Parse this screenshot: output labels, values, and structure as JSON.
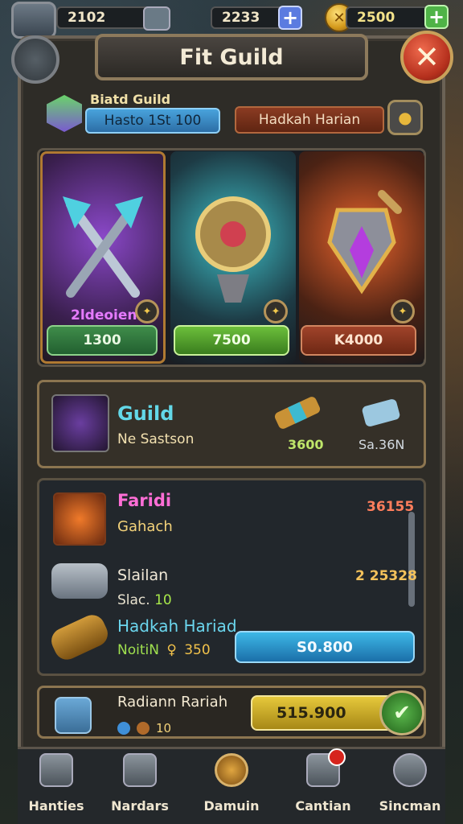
{
  "header": {
    "stat_left": "2102",
    "stat_mid": "2233",
    "stat_right": "2500",
    "title": "Fit Guild",
    "close_glyph": "✕"
  },
  "guild": {
    "label": "Biatd Guild",
    "level_text": "Hasto 1St 100",
    "member_text": "Hadkah Harian"
  },
  "cards": [
    {
      "name": "2ldeoien",
      "price": "1300"
    },
    {
      "price": "7500"
    },
    {
      "price": "K4000"
    }
  ],
  "strip": {
    "title": "Guild",
    "subtitle": "Ne Sastson",
    "value_1": "3600",
    "value_2": "Sa.36N"
  },
  "list": {
    "item1_title": "Faridi",
    "item1_sub": "Gahach",
    "item1_value": "36155",
    "item2_title": "Slailan",
    "item2_value": "2 25328",
    "item2_sub_label": "Slac.",
    "item2_sub_value": "10",
    "item3_title": "Hadkah Hariad",
    "item3_sub_label": "NoitiN",
    "item3_sub_value": "350",
    "button_label": "S0.800"
  },
  "action": {
    "title": "Radiann Rariah",
    "sub_value": "10",
    "button_label": "515.900"
  },
  "nav": [
    {
      "label": "Hanties"
    },
    {
      "label": "Nardars"
    },
    {
      "label": "Damuin"
    },
    {
      "label": "Cantian"
    },
    {
      "label": "Sincman"
    }
  ]
}
